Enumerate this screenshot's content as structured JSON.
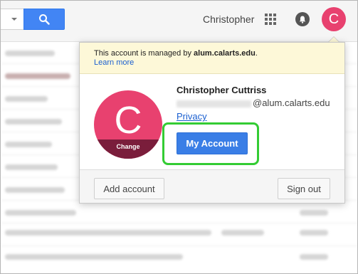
{
  "header": {
    "user_name": "Christopher",
    "avatar_letter": "C",
    "icons": [
      "search-icon",
      "apps-icon",
      "notifications-icon",
      "avatar"
    ]
  },
  "account_popup": {
    "notice_prefix": "This account is managed by ",
    "notice_domain": "alum.calarts.edu",
    "notice_suffix": ".",
    "learn_more": "Learn more",
    "avatar_letter": "C",
    "change_label": "Change",
    "name": "Christopher Cuttriss",
    "email_suffix": "@alum.calarts.edu",
    "privacy": "Privacy",
    "my_account": "My Account",
    "add_account": "Add account",
    "sign_out": "Sign out"
  },
  "colors": {
    "brand_blue": "#4285f4",
    "avatar_pink": "#e8416f",
    "highlight_green": "#33cc33",
    "notice_yellow": "#fdf8d8"
  }
}
